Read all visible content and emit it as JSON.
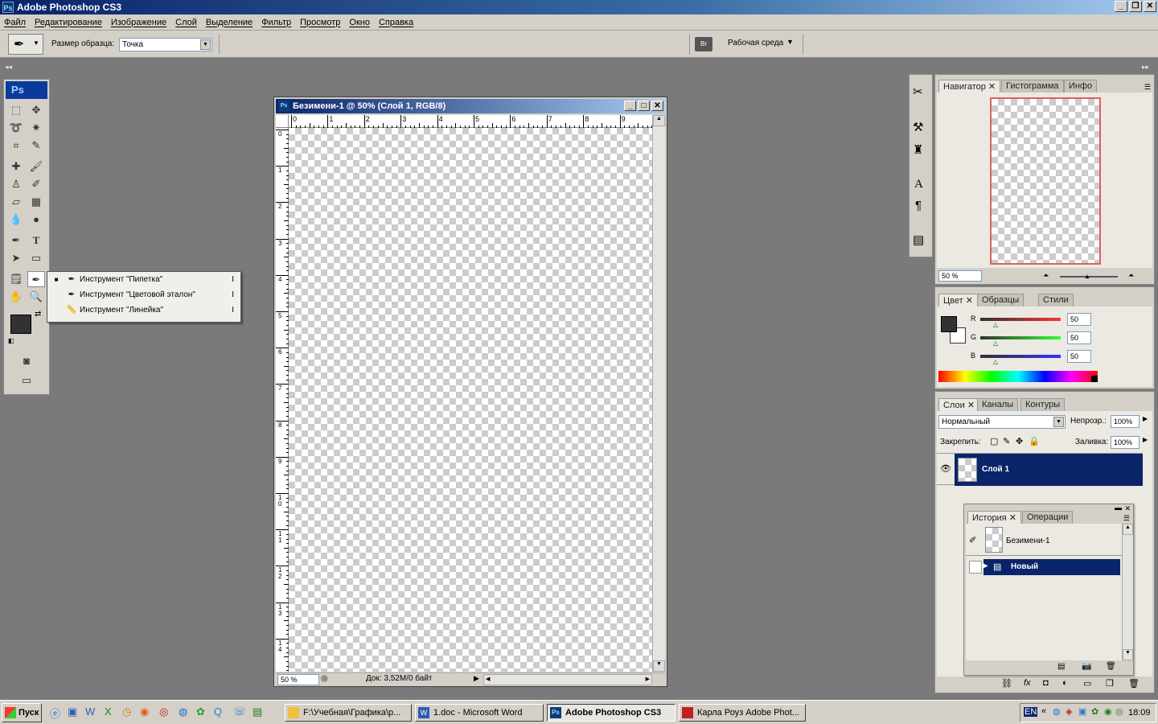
{
  "app": {
    "title": "Adobe Photoshop CS3",
    "ps_badge": "Ps"
  },
  "menu": [
    "Файл",
    "Редактирование",
    "Изображение",
    "Слой",
    "Выделение",
    "Фильтр",
    "Просмотр",
    "Окно",
    "Справка"
  ],
  "options": {
    "sample_label": "Размер образца:",
    "sample_value": "Точка",
    "workspace_label": "Рабочая среда"
  },
  "flyout": {
    "items": [
      {
        "label": "Инструмент \"Пипетка\"",
        "key": "I",
        "selected": true
      },
      {
        "label": "Инструмент \"Цветовой эталон\"",
        "key": "I",
        "selected": false
      },
      {
        "label": "Инструмент \"Линейка\"",
        "key": "I",
        "selected": false
      }
    ]
  },
  "document": {
    "title": "Безимени-1 @ 50% (Слой 1, RGB/8)",
    "zoom": "50 %",
    "doc_info": "Док: 3,52M/0 байт",
    "ruler_h": [
      "0",
      "1",
      "2",
      "3",
      "4",
      "5",
      "6",
      "7",
      "8",
      "9"
    ],
    "ruler_v": [
      "0",
      "1",
      "2",
      "3",
      "4",
      "5",
      "6",
      "7",
      "8",
      "9",
      "10",
      "11",
      "12",
      "13",
      "14"
    ]
  },
  "navigator": {
    "tabs": [
      "Навигатор",
      "Гистограмма",
      "Инфо"
    ],
    "zoom": "50 %"
  },
  "color": {
    "tabs": [
      "Цвет",
      "Образцы",
      "Стили"
    ],
    "channels": [
      {
        "name": "R",
        "value": "50",
        "color": "#ff0000"
      },
      {
        "name": "G",
        "value": "50",
        "color": "#00c000"
      },
      {
        "name": "B",
        "value": "50",
        "color": "#0000ff"
      }
    ],
    "foreground": "#323232"
  },
  "layers": {
    "tabs": [
      "Слои",
      "Каналы",
      "Контуры"
    ],
    "blend_mode": "Нормальный",
    "opacity_label": "Непрозр.:",
    "opacity": "100%",
    "lock_label": "Закрепить:",
    "fill_label": "Заливка:",
    "fill": "100%",
    "items": [
      {
        "name": "Слой 1"
      }
    ]
  },
  "history": {
    "tabs": [
      "История",
      "Операции"
    ],
    "snapshot": "Безимени-1",
    "items": [
      {
        "name": "Новый"
      }
    ]
  },
  "taskbar": {
    "start": "Пуск",
    "buttons": [
      {
        "label": "F:\\Учебная\\Графика\\р...",
        "active": false
      },
      {
        "label": "1.doc - Microsoft Word",
        "active": false
      },
      {
        "label": "Adobe Photoshop CS3",
        "active": true
      },
      {
        "label": "Карла Роуз Adobe Phot...",
        "active": false
      }
    ],
    "lang": "EN",
    "clock": "18:09"
  }
}
